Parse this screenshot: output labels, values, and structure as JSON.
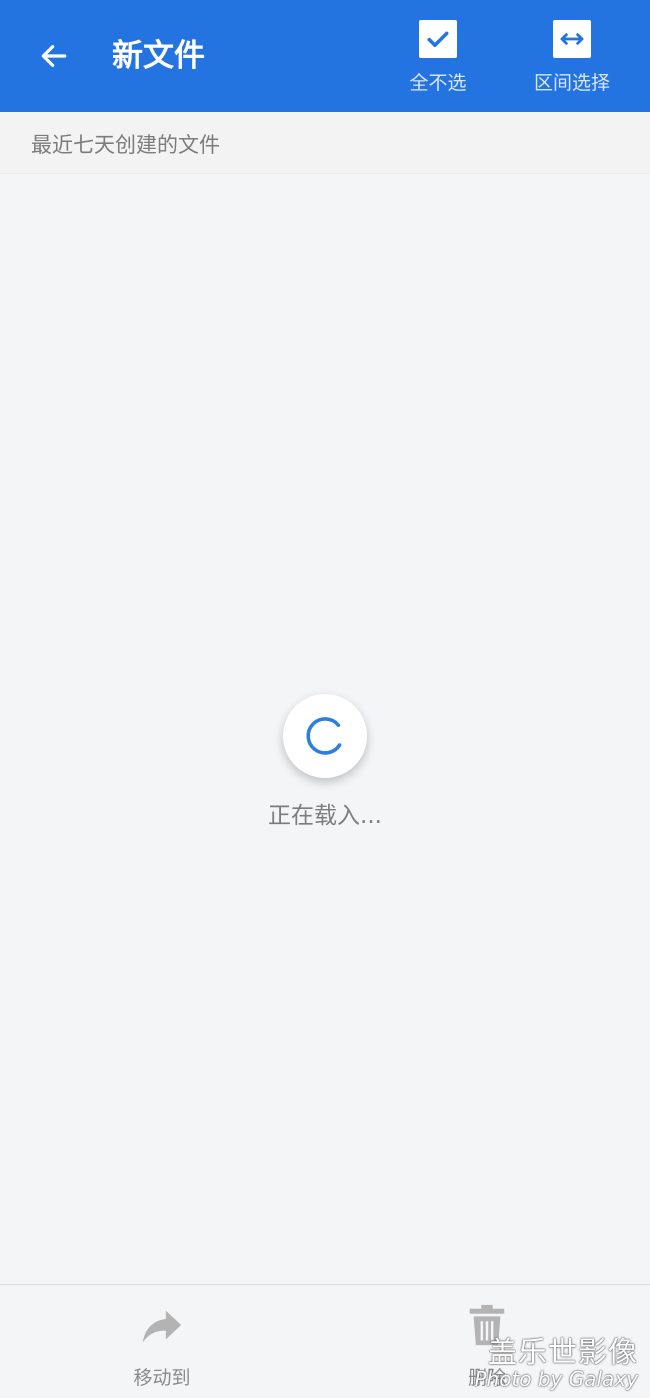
{
  "header": {
    "title": "新文件",
    "back_icon": "arrow-left-icon",
    "actions": [
      {
        "label": "全不选",
        "icon": "checkbox-checked-icon"
      },
      {
        "label": "区间选择",
        "icon": "range-arrows-icon"
      }
    ]
  },
  "sub_header": {
    "text": "最近七天创建的文件"
  },
  "loading": {
    "text": "正在载入..."
  },
  "bottom_bar": {
    "items": [
      {
        "label": "移动到",
        "icon": "share-forward-icon"
      },
      {
        "label": "删除",
        "icon": "trash-icon"
      }
    ]
  },
  "watermark": {
    "line1": "盖乐世影像",
    "line2": "Photo by Galaxy"
  },
  "colors": {
    "accent": "#2374e1",
    "background": "#f4f5f7",
    "muted_text": "#7d7d7d"
  }
}
